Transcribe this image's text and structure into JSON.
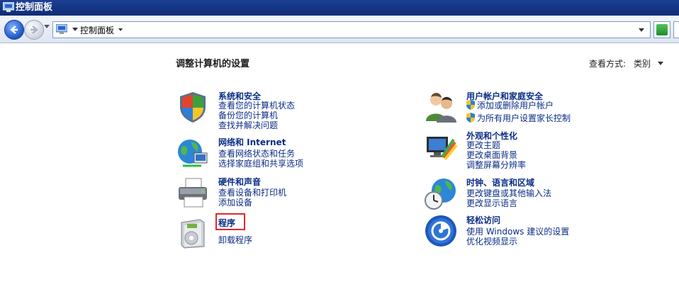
{
  "window": {
    "title": "控制面板"
  },
  "address": {
    "crumb": "控制面板"
  },
  "main": {
    "heading": "调整计算机的设置",
    "view_by_label": "查看方式:",
    "view_by_value": "类别"
  },
  "categories": [
    {
      "title": "系统和安全",
      "links": [
        "查看您的计算机状态",
        "备份您的计算机",
        "查找并解决问题"
      ]
    },
    {
      "title": "网络和 Internet",
      "links": [
        "查看网络状态和任务",
        "选择家庭组和共享选项"
      ]
    },
    {
      "title": "硬件和声音",
      "links": [
        "查看设备和打印机",
        "添加设备"
      ]
    },
    {
      "title": "程序",
      "links": [
        "卸载程序"
      ]
    },
    {
      "title": "用户帐户和家庭安全",
      "links": [
        "添加或删除用户帐户",
        "为所有用户设置家长控制"
      ]
    },
    {
      "title": "外观和个性化",
      "links": [
        "更改主题",
        "更改桌面背景",
        "调整屏幕分辨率"
      ]
    },
    {
      "title": "时钟、语言和区域",
      "links": [
        "更改键盘或其他输入法",
        "更改显示语言"
      ]
    },
    {
      "title": "轻松访问",
      "links": [
        "使用 Windows 建议的设置",
        "优化视频显示"
      ]
    }
  ],
  "icons": {
    "system_security": "shield-icon",
    "network": "globe-network-icon",
    "hardware": "printer-icon",
    "programs": "programs-box-icon",
    "user_accounts": "users-icon",
    "appearance": "monitor-palette-icon",
    "clock_region": "clock-globe-icon",
    "ease_of_access": "accessibility-icon"
  },
  "colors": {
    "link": "#0b2d86",
    "titlebar": "#1c3f95",
    "highlight": "#e0282a"
  }
}
